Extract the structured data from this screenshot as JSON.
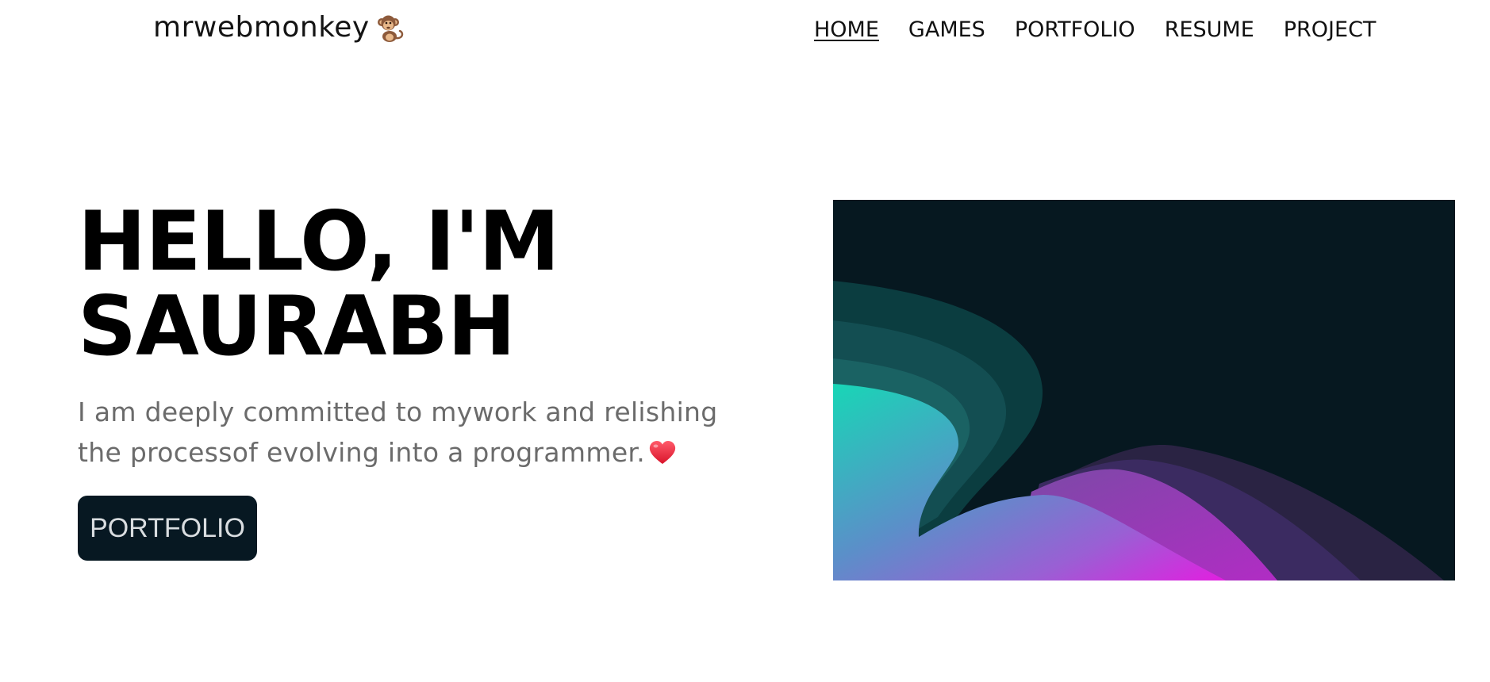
{
  "header": {
    "brand": "mrwebmonkey",
    "brand_icon": "monkey-icon",
    "nav": [
      {
        "label": "HOME",
        "active": true
      },
      {
        "label": "GAMES",
        "active": false
      },
      {
        "label": "PORTFOLIO",
        "active": false
      },
      {
        "label": "RESUME",
        "active": false
      },
      {
        "label": "PROJECT",
        "active": false
      }
    ]
  },
  "hero": {
    "title_line1": "HELLO, I'M",
    "title_line2": "SAURABH",
    "description_line1": "I am deeply committed to mywork and relishing",
    "description_line2": "the processof evolving into a programmer.",
    "description_icon": "heart-icon",
    "button_label": "PORTFOLIO",
    "image_alt": "abstract-wave-illustration"
  },
  "colors": {
    "button_bg": "#071822",
    "art_bg": "#061820",
    "description_text": "#6b6b6b",
    "accent_teal": "#1ad3b5",
    "accent_magenta": "#d82ce0"
  }
}
